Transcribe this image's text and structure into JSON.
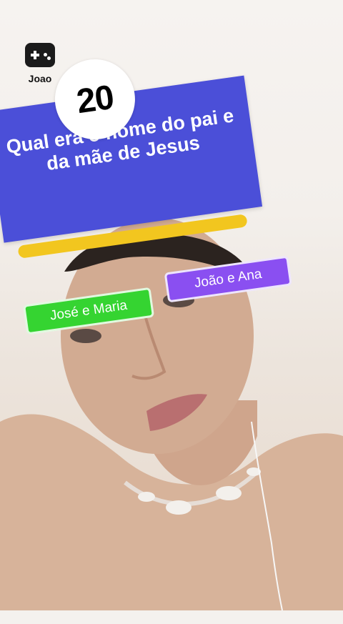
{
  "app": {
    "badge_label": "Joao"
  },
  "timer": {
    "value": "20"
  },
  "question": {
    "text": "Qual era o nome do pai e da mãe de Jesus"
  },
  "progress": {
    "fraction": 0.95,
    "color": "#f2c61f"
  },
  "answers": [
    {
      "label": "José e Maria",
      "color": "#35d431"
    },
    {
      "label": "João e Ana",
      "color": "#8a4ff1"
    }
  ],
  "colors": {
    "question_card": "#4b4fd8",
    "timer_bg": "#ffffff"
  }
}
